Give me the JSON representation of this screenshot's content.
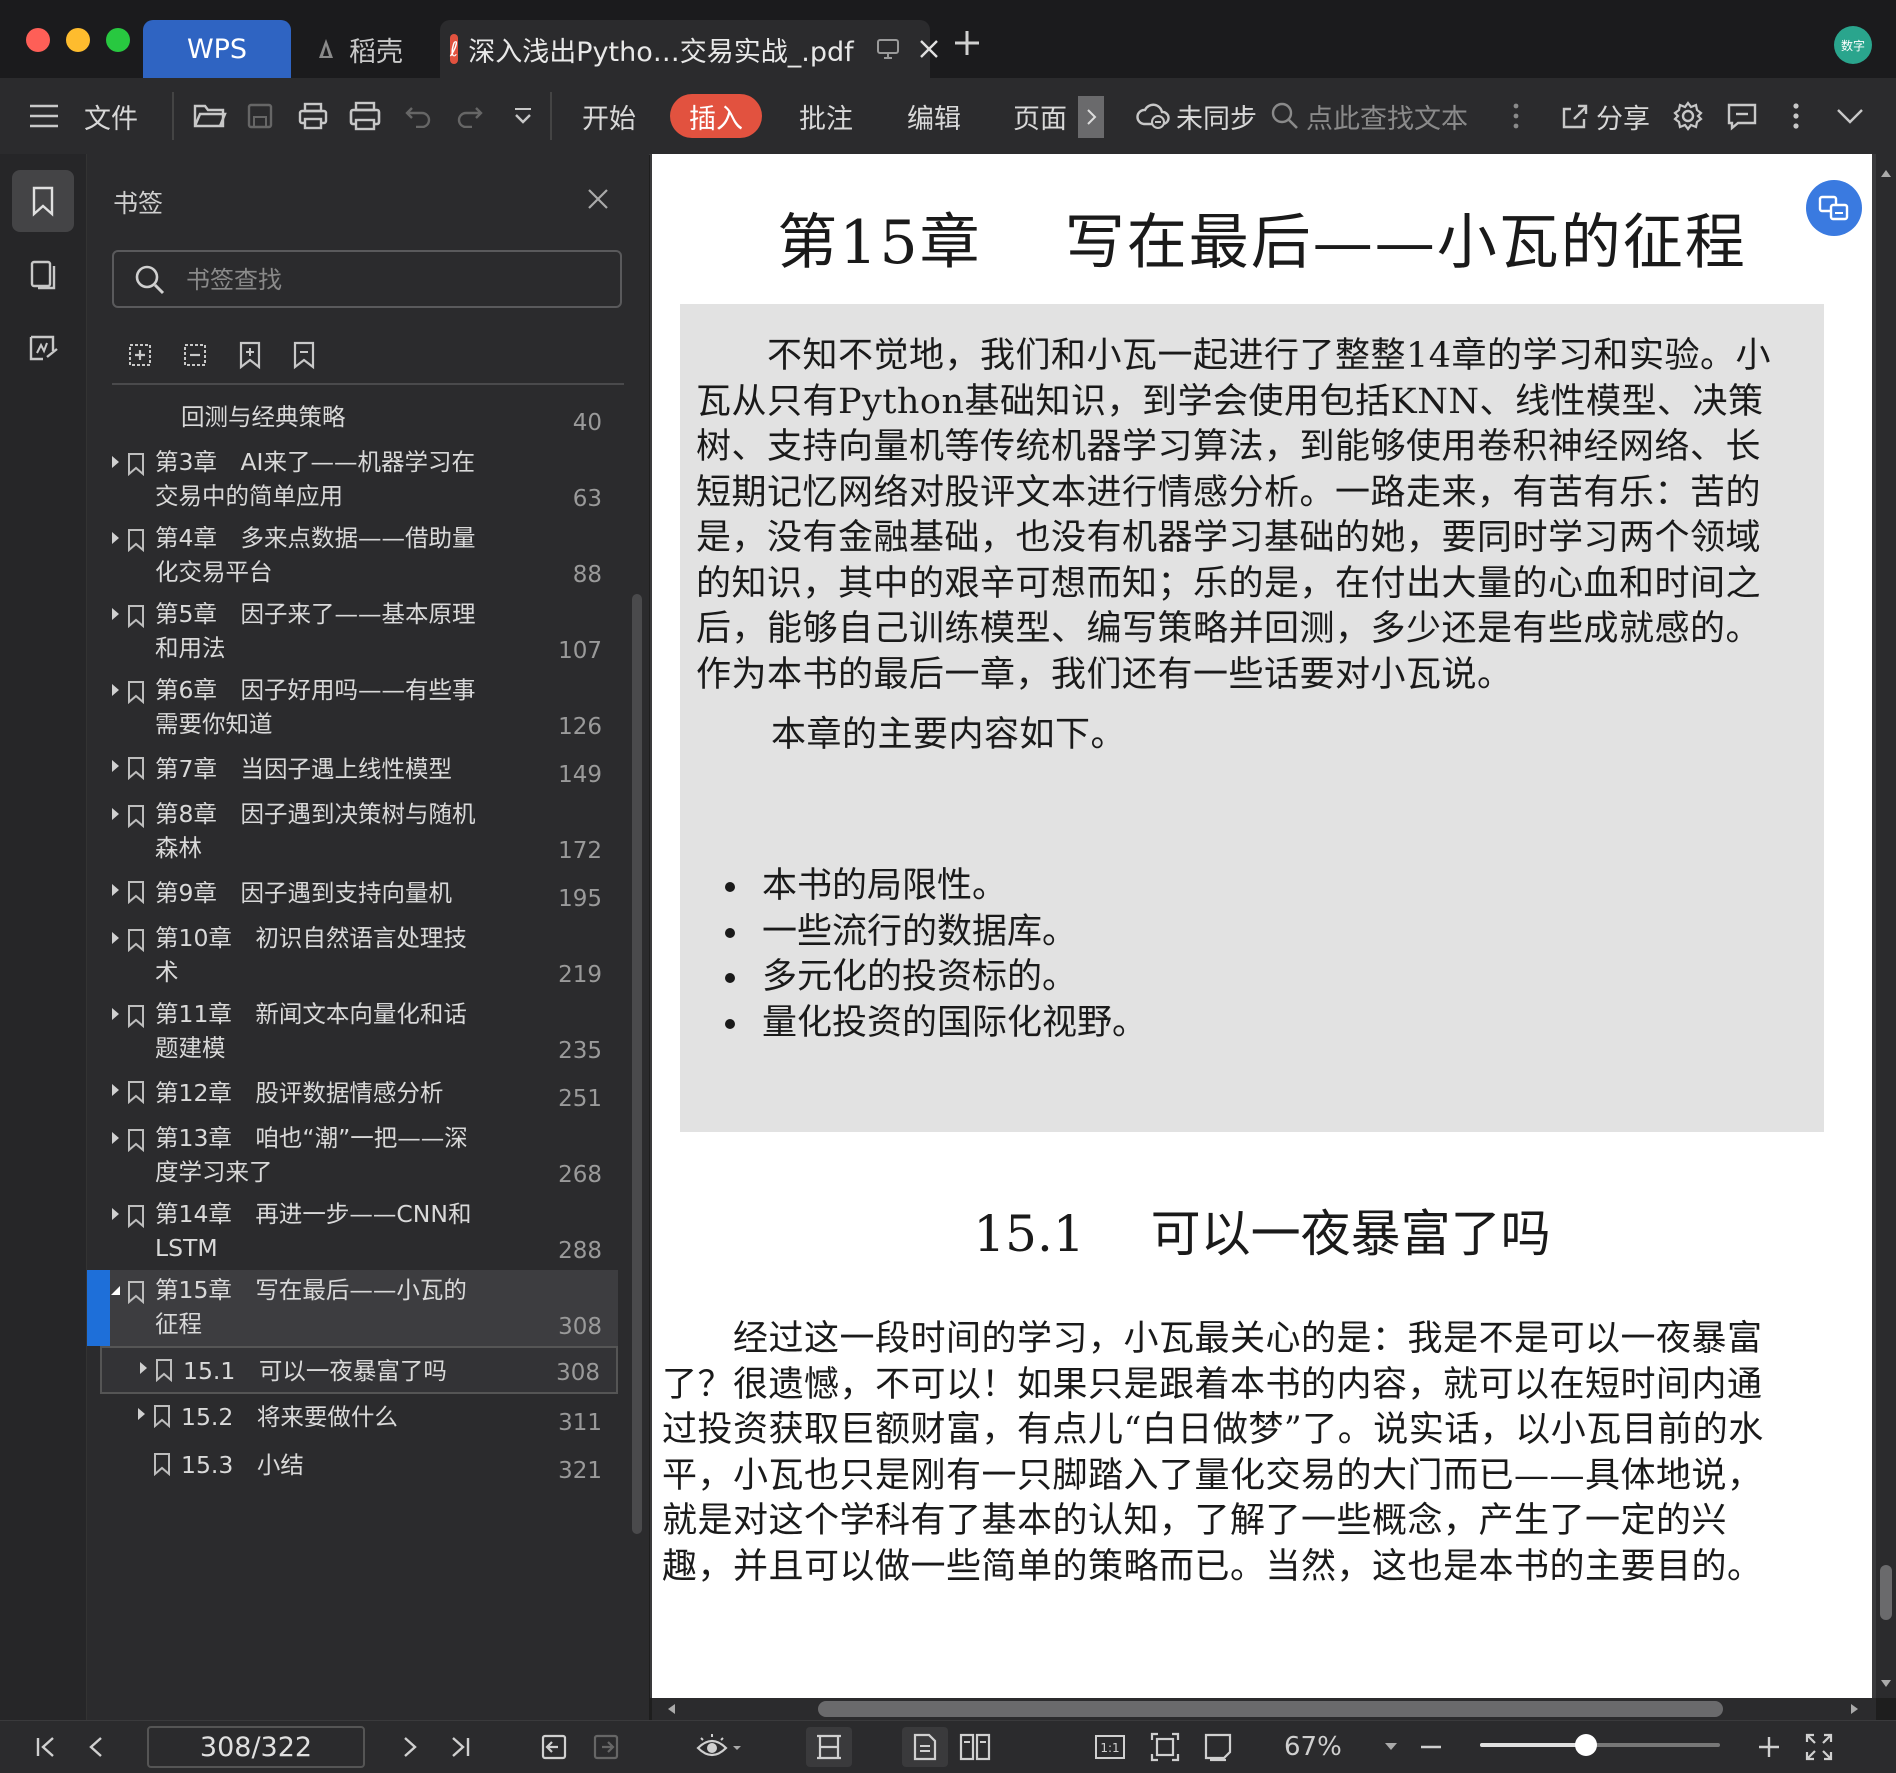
{
  "titlebar": {
    "tabs": [
      {
        "label": "WPS"
      },
      {
        "label": "稻壳"
      },
      {
        "label": "深入浅出Pytho…交易实战_.pdf"
      }
    ],
    "avatar_text": "数字"
  },
  "toolbar": {
    "file_label": "文件",
    "menus": [
      "开始",
      "插入",
      "批注",
      "编辑",
      "页面"
    ],
    "active_menu": "插入",
    "sync_label": "未同步",
    "search_placeholder": "点此查找文本",
    "share_label": "分享"
  },
  "bookmarks": {
    "title": "书签",
    "search_placeholder": "书签查找",
    "items": [
      {
        "title": "回测与经典策略",
        "page": "40",
        "level": 1,
        "arrow": false
      },
      {
        "title": "第3章　AI来了——机器学习在\n交易中的简单应用",
        "page": "63",
        "level": 0,
        "arrow": true
      },
      {
        "title": "第4章　多来点数据——借助量\n化交易平台",
        "page": "88",
        "level": 0,
        "arrow": true
      },
      {
        "title": "第5章　因子来了——基本原理\n和用法",
        "page": "107",
        "level": 0,
        "arrow": true
      },
      {
        "title": "第6章　因子好用吗——有些事\n需要你知道",
        "page": "126",
        "level": 0,
        "arrow": true
      },
      {
        "title": "第7章　当因子遇上线性模型",
        "page": "149",
        "level": 0,
        "arrow": true
      },
      {
        "title": "第8章　因子遇到决策树与随机\n森林",
        "page": "172",
        "level": 0,
        "arrow": true
      },
      {
        "title": "第9章　因子遇到支持向量机",
        "page": "195",
        "level": 0,
        "arrow": true
      },
      {
        "title": "第10章　初识自然语言处理技\n术",
        "page": "219",
        "level": 0,
        "arrow": true
      },
      {
        "title": "第11章　新闻文本向量化和话\n题建模",
        "page": "235",
        "level": 0,
        "arrow": true
      },
      {
        "title": "第12章　股评数据情感分析",
        "page": "251",
        "level": 0,
        "arrow": true
      },
      {
        "title": "第13章　咱也“潮”一把——深\n度学习来了",
        "page": "268",
        "level": 0,
        "arrow": true
      },
      {
        "title": "第14章　再进一步——CNN和\nLSTM",
        "page": "288",
        "level": 0,
        "arrow": true
      },
      {
        "title": "第15章　写在最后——小瓦的\n征程",
        "page": "308",
        "level": 0,
        "arrow": true,
        "expanded": true,
        "selected": true
      },
      {
        "title": "15.1　可以一夜暴富了吗",
        "page": "308",
        "level": 1,
        "arrow": true,
        "focused": true
      },
      {
        "title": "15.2　将来要做什么",
        "page": "311",
        "level": 1,
        "arrow": true
      },
      {
        "title": "15.3　小结",
        "page": "321",
        "level": 1,
        "arrow": false
      }
    ]
  },
  "document": {
    "chapter_title": "第15章　 写在最后——小瓦的征程",
    "intro_lines": [
      "　　不知不觉地，我们和小瓦一起进行了整整14章的学习和实验。小",
      "瓦从只有Python基础知识，到学会使用包括KNN、线性模型、决策",
      "树、支持向量机等传统机器学习算法，到能够使用卷积神经网络、长",
      "短期记忆网络对股评文本进行情感分析。一路走来，有苦有乐：苦的",
      "是，没有金融基础，也没有机器学习基础的她，要同时学习两个领域",
      "的知识，其中的艰辛可想而知；乐的是，在付出大量的心血和时间之",
      "后，能够自己训练模型、编写策略并回测，多少还是有些成就感的。",
      "作为本书的最后一章，我们还有一些话要对小瓦说。"
    ],
    "contents_intro": "　　本章的主要内容如下。",
    "bullets": [
      "本书的局限性。",
      "一些流行的数据库。",
      "多元化的投资标的。",
      "量化投资的国际化视野。"
    ],
    "section_title": "15.1　 可以一夜暴富了吗",
    "body_lines": [
      "　　经过这一段时间的学习，小瓦最关心的是：我是不是可以一夜暴富",
      "了？很遗憾，不可以！如果只是跟着本书的内容，就可以在短时间内通",
      "过投资获取巨额财富，有点儿“白日做梦”了。说实话，以小瓦目前的水",
      "平，小瓦也只是刚有一只脚踏入了量化交易的大门而已——具体地说，",
      "就是对这个学科有了基本的认知，了解了一些概念，产生了一定的兴",
      "趣，并且可以做一些简单的策略而已。当然，这也是本书的主要目的。"
    ]
  },
  "statusbar": {
    "page_indicator": "308/322",
    "zoom": "67%",
    "zoom_slider_fraction": 0.44
  },
  "colors": {
    "accent_red": "#e2523f",
    "accent_blue": "#2f64c2",
    "selection_blue": "#1e6fd9"
  }
}
